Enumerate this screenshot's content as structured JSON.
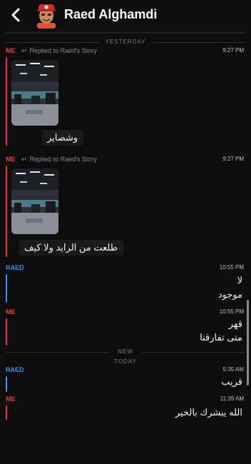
{
  "header": {
    "title": "Raed Alghamdi"
  },
  "dividers": {
    "yesterday": "YESTERDAY",
    "new": "NEW",
    "today": "TODAY"
  },
  "messages": [
    {
      "sender": "ME",
      "reply_note": "Replied to Raed's Story",
      "time": "9:27 PM",
      "caption": "وشصاير"
    },
    {
      "sender": "ME",
      "reply_note": "Replied to Raed's Story",
      "time": "9:27 PM",
      "caption": "طلعت من الرايد ولا كيف"
    },
    {
      "sender": "RAED",
      "time": "10:55 PM",
      "lines": [
        "لا",
        "موجود"
      ]
    },
    {
      "sender": "ME",
      "time": "10:55 PM",
      "lines": [
        "قهر",
        "متى تفارقنا"
      ]
    },
    {
      "sender": "RAED",
      "time": "5:35 AM",
      "lines": [
        "قريب"
      ]
    },
    {
      "sender": "ME",
      "time": "11:39 AM",
      "lines": [
        "الله يبشرك بالخير"
      ]
    }
  ],
  "colors": {
    "me": "#f0364d",
    "raed": "#3b8ff5",
    "background": "#0d0d0d"
  },
  "icons": {
    "back": "chevron-left-icon",
    "reply": "reply-arrow-icon"
  }
}
